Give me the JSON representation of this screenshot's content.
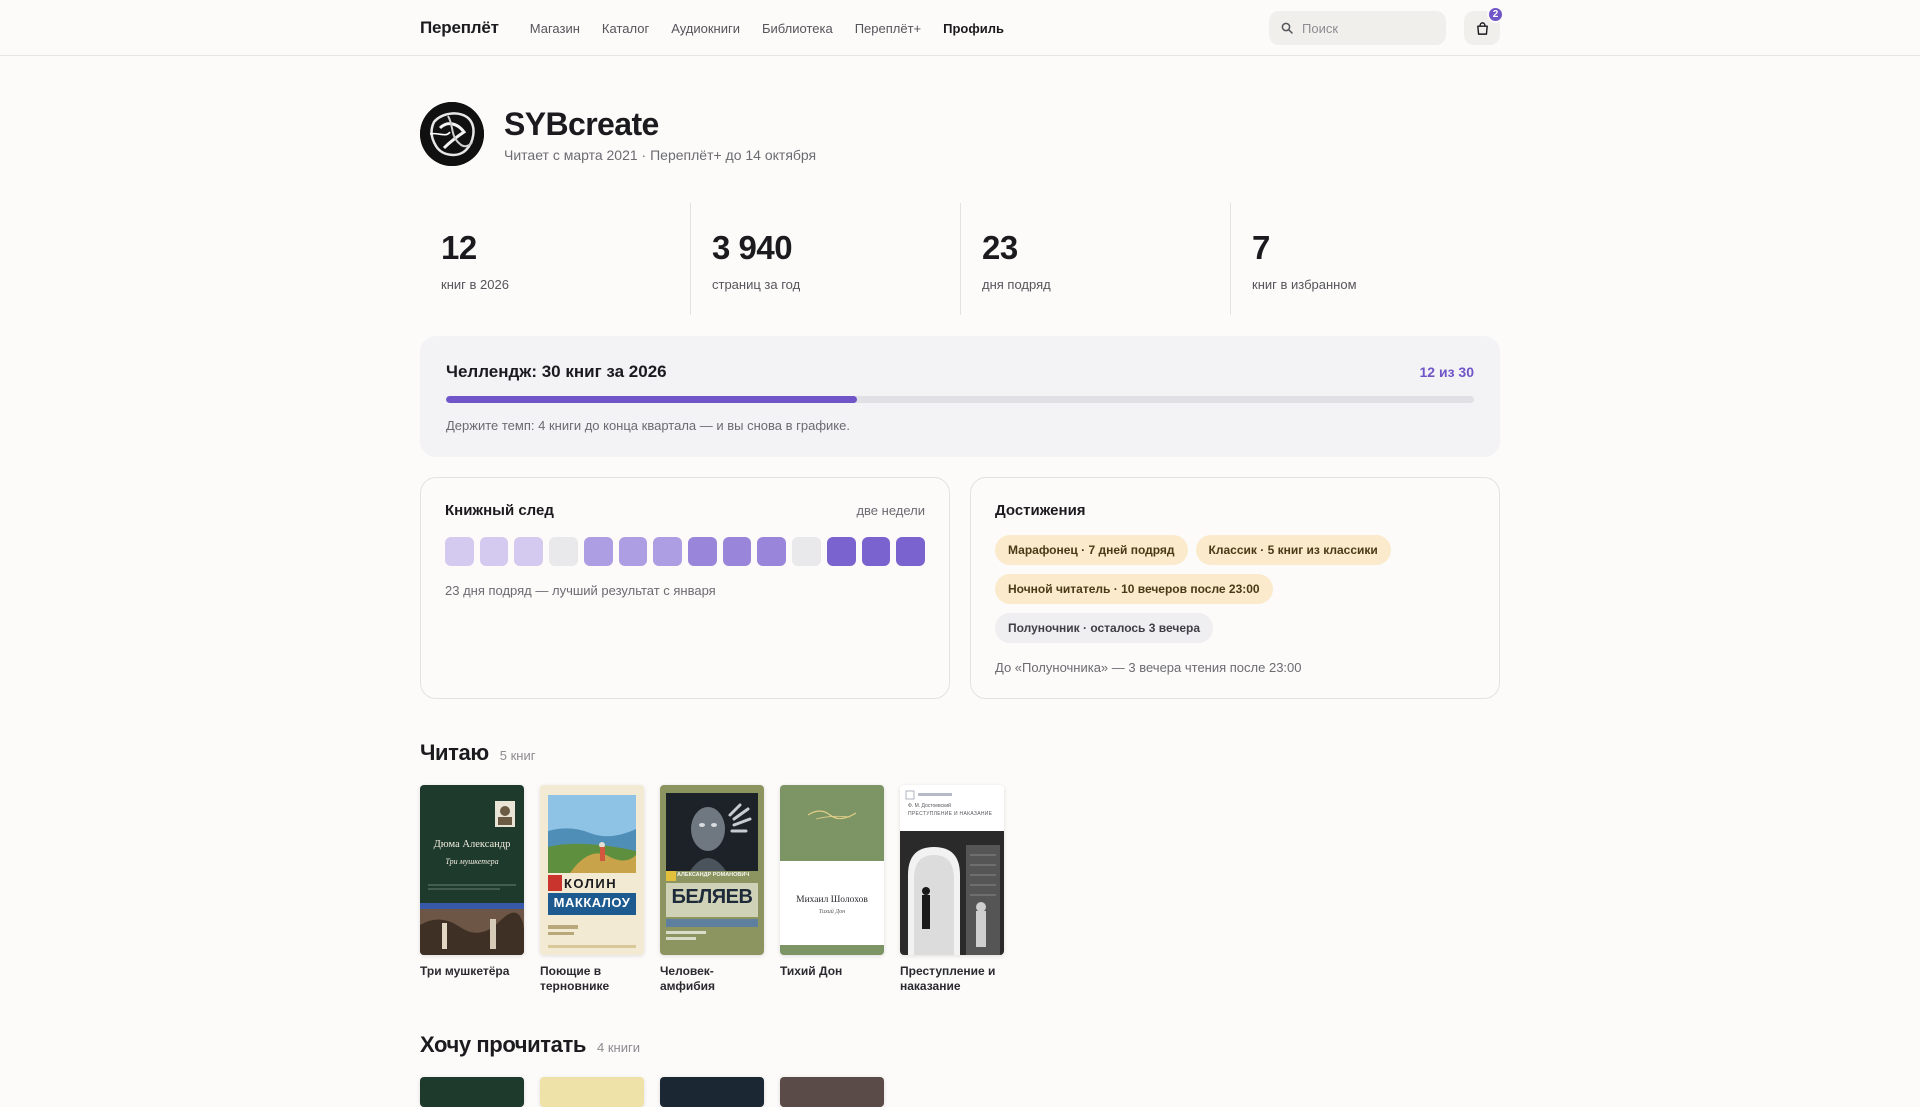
{
  "header": {
    "logo": "Переплёт",
    "nav": [
      {
        "label": "Магазин",
        "active": false
      },
      {
        "label": "Каталог",
        "active": false
      },
      {
        "label": "Аудиокниги",
        "active": false
      },
      {
        "label": "Библиотека",
        "active": false
      },
      {
        "label": "Переплёт+",
        "active": false
      },
      {
        "label": "Профиль",
        "active": true
      }
    ],
    "search_placeholder": "Поиск",
    "cart_count": "2"
  },
  "profile": {
    "username": "SYBcreate",
    "meta": "Читает с марта 2021 · Переплёт+ до 14 октября"
  },
  "stats": [
    {
      "value": "12",
      "label": "книг в 2026"
    },
    {
      "value": "3 940",
      "label": "страниц за год"
    },
    {
      "value": "23",
      "label": "дня подряд"
    },
    {
      "value": "7",
      "label": "книг в избранном"
    }
  ],
  "challenge": {
    "title": "Челлендж: 30 книг за 2026",
    "count": "12 из 30",
    "progress": 0.4,
    "hint": "Держите темп: 4 книги до конца квартала — и вы снова в графике."
  },
  "trail": {
    "title": "Книжный след",
    "period": "две недели",
    "levels": [
      1,
      1,
      1,
      0,
      2,
      2,
      2,
      3,
      3,
      3,
      0,
      4,
      4,
      4
    ],
    "colors": [
      "#e9e8ea",
      "#d4c9ef",
      "#ad9de2",
      "#9985d9",
      "#7b63cf"
    ],
    "caption": "23 дня подряд — лучший результат с января"
  },
  "achievements": {
    "title": "Достижения",
    "badges": [
      {
        "label": "Марафонец · 7 дней подряд",
        "earned": true
      },
      {
        "label": "Классик · 5 книг из классики",
        "earned": true
      },
      {
        "label": "Ночной читатель · 10 вечеров после 23:00",
        "earned": true
      },
      {
        "label": "Полуночник · осталось 3 вечера",
        "earned": false
      }
    ],
    "caption": "До «Полуночника» — 3 вечера чтения после 23:00"
  },
  "reading": {
    "title": "Читаю",
    "count": "5 книг",
    "books": [
      {
        "title": "Три мушкетёра",
        "cover_author": "Дюма Александр",
        "cover_title": "Три мушкетера",
        "accent": "#1e3a2c"
      },
      {
        "title": "Поющие в терновнике",
        "cover_author": "КОЛИН",
        "cover_title": "МАККАЛОУ",
        "accent": "#f2ead2"
      },
      {
        "title": "Человек-амфибия",
        "cover_author": "АЛЕКСАНДР РОМАНОВИЧ",
        "cover_title": "БЕЛЯЕВ",
        "accent": "#8c9460"
      },
      {
        "title": "Тихий Дон",
        "cover_author": "Михаил Шолохов",
        "cover_title": "Тихий Дон",
        "accent": "#7d9464"
      },
      {
        "title": "Преступление и наказание",
        "cover_author": "Ф. М. Достоевский",
        "cover_title": "ПРЕСТУПЛЕНИЕ И НАКАЗАНИЕ",
        "accent": "#ffffff"
      }
    ]
  },
  "want": {
    "title": "Хочу прочитать",
    "count": "4 книги"
  }
}
